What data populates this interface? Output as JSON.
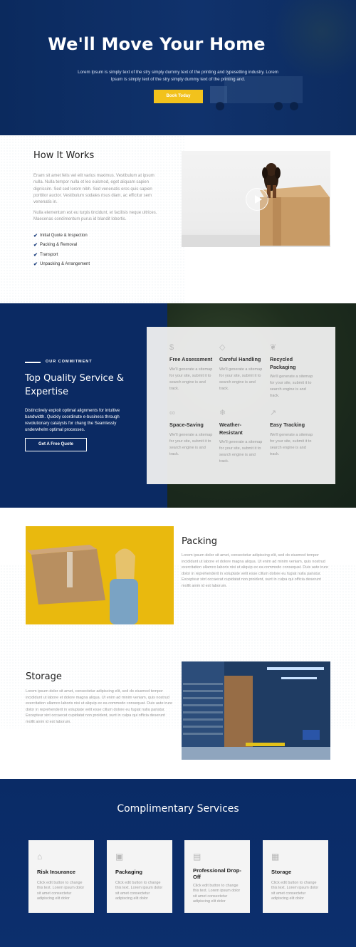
{
  "hero": {
    "title": "We'll Move Your Home",
    "subtitle": "Lorem Ipsum is simply text of the stry simply dummy text of the printing and typesetting industry. Lorem Ipsum is simply text of the stry simply dummy text of the printing and.",
    "button": "Book Today"
  },
  "how": {
    "title": "How It Works",
    "para1": "Enam sit amet felis vel elit varius maximus. Vestibulum at ipsum nulla. Nulla tempor nulla et leo euismod, eget aliquam sapien dignissim. Sed sed lorem nibh. Sed venenatis eros quis sapien porttitor auctor. Vestibulum sodales risus diam, ac efficitur sem venenatis in.",
    "para2": "Nulla elementum est eu turpis tincidunt, et facilisis neque ultrices. Maecenas condimentum purus id blandit lobortis.",
    "steps": [
      "Initial Quote & Inspection",
      "Packing & Removal",
      "Transport",
      "Unpacking & Arrangement"
    ]
  },
  "commitment": {
    "eyebrow": "OUR COMMITMENT",
    "title": "Top Quality Service & Expertise",
    "description": "Distinctively exploit optimal alignments for intuitive bandwidth. Quickly coordinate e-business through revolutionary catalysts for chang the Seamlessly underwhelm optimal processes.",
    "button": "Get A Free Quote",
    "features": [
      {
        "icon": "dollar-icon",
        "title": "Free Assessment",
        "text": "We'll generate a sitemap for your site, submit it to search engine is and track."
      },
      {
        "icon": "diamond-icon",
        "title": "Careful Handling",
        "text": "We'll generate a sitemap for your site, submit it to search engine is and track."
      },
      {
        "icon": "leaf-icon",
        "title": "Recycled Packaging",
        "text": "We'll generate a sitemap for your site, submit it to search engine is and track."
      },
      {
        "icon": "link-icon",
        "title": "Space-Saving",
        "text": "We'll generate a sitemap for your site, submit it to search engine is and track."
      },
      {
        "icon": "snowflake-icon",
        "title": "Weather-Resistant",
        "text": "We'll generate a sitemap for your site, submit it to search engine is and track."
      },
      {
        "icon": "chart-icon",
        "title": "Easy Tracking",
        "text": "We'll generate a sitemap for your site, submit it to search engine is and track."
      }
    ]
  },
  "packing": {
    "title": "Packing",
    "text": "Lorem ipsum dolor sit amet, consectetur adipiscing elit, sed do eiusmod tempor incididunt ut labore et dolore magna aliqua. Ut enim ad minim veniam, quis nostrud exercitation ullamco laboris nisi ut aliquip ex ea commodo consequat. Duis aute irure dolor in reprehenderit in voluptate velit esse cillum dolore eu fugiat nulla pariatur. Excepteur sint occaecat cupidatat non proident, sunt in culpa qui officia deserunt mollit anim id est laborum."
  },
  "storage": {
    "title": "Storage",
    "text": "Lorem ipsum dolor sit amet, consectetur adipiscing elit, sed do eiusmod tempor incididunt ut labore et dolore magna aliqua. Ut enim ad minim veniam, quis nostrud exercitation ullamco laboris nisi ut aliquip ex ea commodo consequat. Duis aute irure dolor in reprehenderit in voluptate velit esse cillum dolore eu fugiat nulla pariatur. Excepteur sint occaecat cupidatat non proident, sunt in culpa qui officia deserunt mollit anim id est laborum."
  },
  "complimentary": {
    "title": "Complimentary Services",
    "services": [
      {
        "icon": "building-icon",
        "title": "Risk Insurance",
        "text": "Click edit button to change this text. Lorem ipsum dolor sit amet consectetur adipiscing elit dolor"
      },
      {
        "icon": "box-icon",
        "title": "Packaging",
        "text": "Click edit button to change this text. Lorem ipsum dolor sit amet consectetur adipiscing elit dolor"
      },
      {
        "icon": "store-icon",
        "title": "Professional Drop-Off",
        "text": "Click edit button to change this text. Lorem ipsum dolor sit amet consectetur adipiscing elit dolor"
      },
      {
        "icon": "cabinet-icon",
        "title": "Storage",
        "text": "Click edit button to change this text. Lorem ipsum dolor sit amet consectetur adipiscing elit dolor"
      }
    ]
  },
  "colors": {
    "navy": "#0b2a63",
    "accent": "#f2c21c",
    "card": "#f4f4f4"
  }
}
